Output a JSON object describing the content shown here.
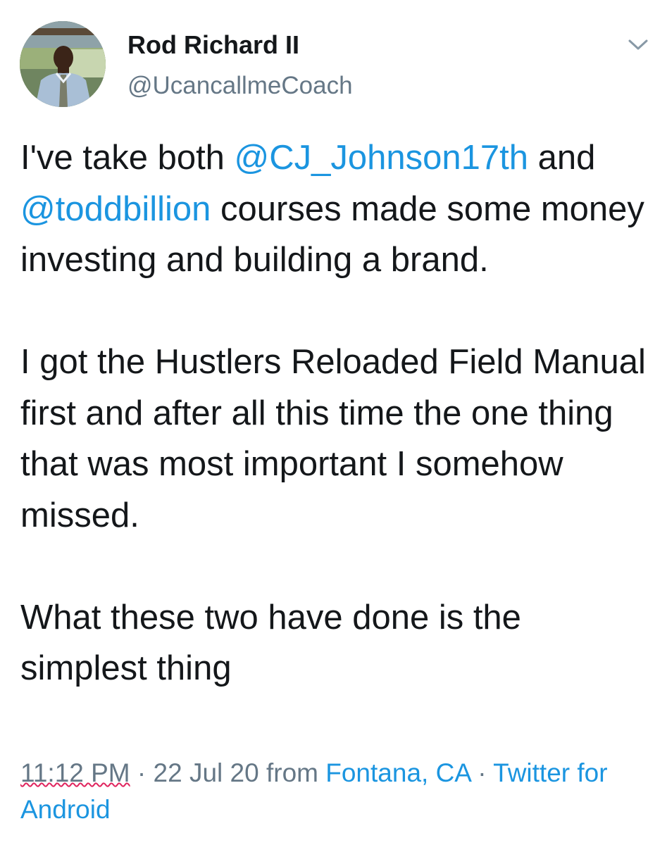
{
  "user": {
    "display_name": "Rod Richard II",
    "handle": "@UcancallmeCoach",
    "avatar_icon": "profile-photo"
  },
  "menu": {
    "icon": "chevron-down-icon"
  },
  "tweet": {
    "para1": {
      "t1": "I've take both ",
      "mention1": "@CJ_Johnson17th",
      "t2": " and ",
      "mention2": "@toddbillion",
      "t3": " courses made some money investing and building a brand."
    },
    "para2": "I got the Hustlers Reloaded Field Manual first and after all this time the one thing that was most important I somehow missed.",
    "para3": "What these two have done is the simplest thing"
  },
  "meta": {
    "time": "11:12 PM",
    "sep1": " · ",
    "date_from": "22 Jul 20 from ",
    "location": "Fontana, CA",
    "sep2": " · ",
    "client": "Twitter for Android"
  },
  "colors": {
    "text": "#14171a",
    "secondary": "#657786",
    "link": "#1b95e0",
    "underline": "#e0245e"
  }
}
